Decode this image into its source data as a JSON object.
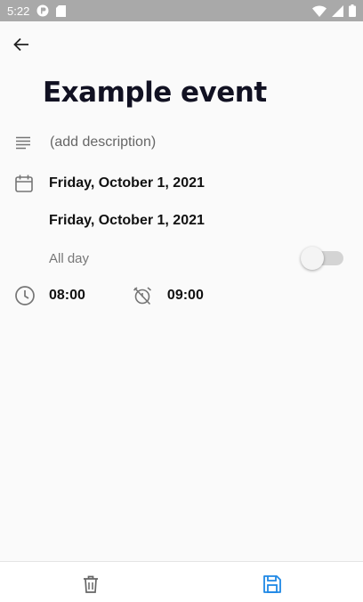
{
  "status_bar": {
    "time": "5:22",
    "icons": [
      "notification-app-icon",
      "sd-card-icon",
      "wifi-icon",
      "signal-icon",
      "battery-icon"
    ]
  },
  "header": {
    "back_icon": "arrow-left-icon",
    "title": "Example event"
  },
  "form": {
    "description_placeholder": "(add description)",
    "start_date": "Friday, October 1, 2021",
    "end_date": "Friday, October 1, 2021",
    "all_day_label": "All day",
    "all_day_enabled": false,
    "start_time": "08:00",
    "end_time": "09:00"
  },
  "bottom_bar": {
    "delete_icon": "trash-icon",
    "save_icon": "save-icon",
    "accent": "#1e88e5"
  },
  "colors": {
    "status_bar": "#a9a9a9",
    "background": "#fafafa",
    "icon_gray": "#757575"
  }
}
